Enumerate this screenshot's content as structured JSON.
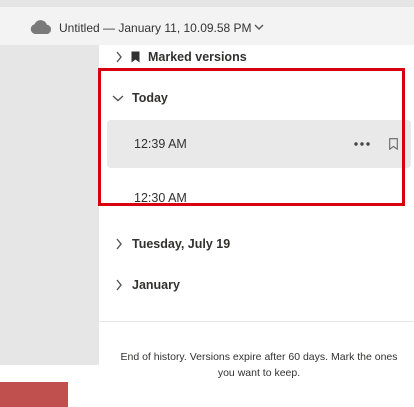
{
  "titlebar": {
    "icon": "cloud-icon",
    "document_title": "Untitled — January 11, 10.09.58 PM",
    "dropdown_icon": "chevron-down-icon"
  },
  "history": {
    "marked_versions_label": "Marked versions",
    "groups": [
      {
        "label": "Today",
        "expanded": true
      },
      {
        "label": "Tuesday, July 19",
        "expanded": false
      },
      {
        "label": "January",
        "expanded": false
      }
    ],
    "today_versions": [
      {
        "time": "12:39 AM",
        "selected": true
      },
      {
        "time": "12:30 AM",
        "selected": false
      }
    ],
    "footer_text": "End of history. Versions expire after 60 days. Mark the ones you want to keep."
  },
  "colors": {
    "highlight_border": "#d6000f",
    "selected_row": "#e9e9e9",
    "left_pane": "#e6e6e6",
    "red_block": "#c0504d"
  }
}
